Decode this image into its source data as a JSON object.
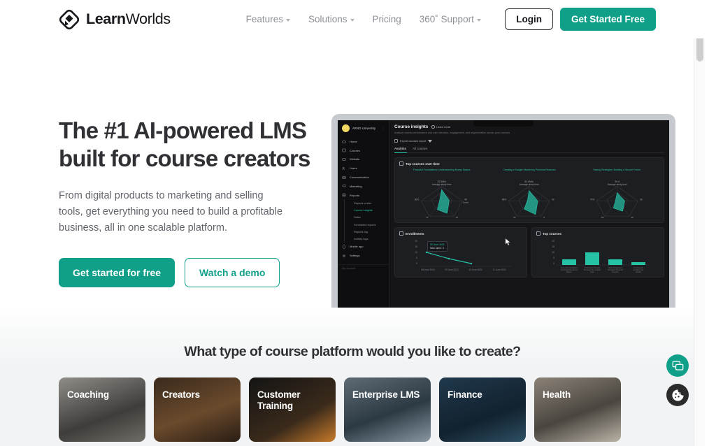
{
  "brand": {
    "name_bold": "Learn",
    "name_light": "Worlds",
    "accent": "#10a08a",
    "dark": "#2e3034"
  },
  "header": {
    "nav": [
      {
        "label": "Features",
        "has_caret": true
      },
      {
        "label": "Solutions",
        "has_caret": true
      },
      {
        "label": "Pricing",
        "has_caret": false
      },
      {
        "label": "360˚ Support",
        "has_caret": true
      }
    ],
    "login_label": "Login",
    "cta_label": "Get Started Free"
  },
  "hero": {
    "title_line1": "The #1 AI-powered LMS",
    "title_line2": "built for course creators",
    "subtitle": "From digital products to marketing and selling tools, get everything you need to build a profitable business, all in one scalable platform.",
    "primary_cta": "Get started for free",
    "secondary_cta": "Watch a demo"
  },
  "dashboard": {
    "workspace": "ARNO University",
    "title": "Course insights",
    "learn_more": "Learn more",
    "description": "Analyze course performance and user behavior, engagement, and segmentation across your courses",
    "export_label": "Export courses report",
    "tabs": [
      {
        "label": "Analytics",
        "active": true
      },
      {
        "label": "All courses",
        "active": false
      }
    ],
    "sidebar": [
      {
        "label": "Home",
        "icon": "home-icon"
      },
      {
        "label": "Courses",
        "icon": "courses-icon"
      },
      {
        "label": "Website",
        "icon": "website-icon"
      },
      {
        "label": "Users",
        "icon": "users-icon"
      },
      {
        "label": "Communication",
        "icon": "mail-icon"
      },
      {
        "label": "Marketing",
        "icon": "marketing-icon"
      },
      {
        "label": "Reports",
        "icon": "reports-icon"
      }
    ],
    "sidebar_sub": [
      {
        "label": "Reports center",
        "active": false
      },
      {
        "label": "Course insights",
        "active": true
      },
      {
        "label": "Sales",
        "active": false
      },
      {
        "label": "Scheduled reports",
        "active": false
      },
      {
        "label": "Reports log",
        "active": false
      },
      {
        "label": "Activity logs",
        "active": false
      }
    ],
    "sidebar_bottom": [
      {
        "label": "Mobile app",
        "icon": "mobile-icon"
      },
      {
        "label": "Settings",
        "icon": "gear-icon"
      }
    ],
    "sidebar_footer": "My account",
    "top_courses_panel_title": "Top courses over time",
    "enrollments_panel_title": "Enrollments",
    "top_courses_bar_panel_title": "Top courses",
    "tooltip": {
      "date": "09 June 2024",
      "value": "New users: 3"
    }
  },
  "chart_data": [
    {
      "type": "radar",
      "title": "Top courses over time",
      "axes": [
        "Average study time",
        "Social interactions",
        "Certificates issued",
        "Enrollments",
        "Average grade"
      ],
      "series": [
        {
          "name": "Financial Foundations: Understanding Money Basics",
          "values": [
            32,
            58,
            34,
            72,
            48
          ],
          "labels": [
            "32.5Min Average study time",
            "48 Social interactions",
            "12 Certificates issued",
            "72 Enrollments",
            "66% Average grade"
          ]
        },
        {
          "name": "Creating a Budget: Mastering Personal Finances",
          "values": [
            30,
            55,
            38,
            66,
            45
          ],
          "labels": [
            "81.5Min Average study time",
            "42 Social interactions",
            "8 Certificates issued",
            "64 Enrollments",
            "88% Average grade"
          ]
        },
        {
          "name": "Saving Strategies: Building a Secure Future",
          "values": [
            28,
            50,
            32,
            60,
            42
          ],
          "labels": [
            "30.6Min Average study time",
            "38 Social interactions",
            "20 Certificates issued",
            "56 Enrollments",
            "79% Average grade"
          ]
        }
      ]
    },
    {
      "type": "line",
      "title": "Enrollments",
      "xlabel": "",
      "ylabel": "",
      "x": [
        "08 June 2024",
        "09 June 2024",
        "10 June 2024",
        "11 June 2024"
      ],
      "values": [
        10,
        5,
        1,
        1
      ],
      "ylim": [
        0,
        20
      ],
      "yticks": [
        0,
        5,
        10,
        15,
        20
      ],
      "grid": false
    },
    {
      "type": "bar",
      "title": "Top courses",
      "categories": [
        "Financial Foundations Understanding Money Basics",
        "Retirement Planning Securing Your Golden Years",
        "Debt Management Strategies for Financial Freedom",
        "Investing 101 Growing Your Wealth"
      ],
      "values": [
        6,
        13,
        6,
        3
      ],
      "ylim": [
        0,
        20
      ],
      "yticks": [
        0,
        5,
        10,
        15,
        20
      ],
      "xlabel": "",
      "ylabel": ""
    }
  ],
  "section": {
    "title": "What type of course platform would you like to create?",
    "cards": [
      {
        "label": "Coaching",
        "theme": "c1"
      },
      {
        "label": "Creators",
        "theme": "c2"
      },
      {
        "label": "Customer Training",
        "theme": "c3"
      },
      {
        "label": "Enterprise LMS",
        "theme": "c4"
      },
      {
        "label": "Finance",
        "theme": "c5"
      },
      {
        "label": "Health",
        "theme": "c6"
      }
    ]
  },
  "fabs": [
    {
      "name": "chat-icon",
      "color": "#10a08a"
    },
    {
      "name": "cookie-icon",
      "color": "#2b2b2b"
    }
  ]
}
